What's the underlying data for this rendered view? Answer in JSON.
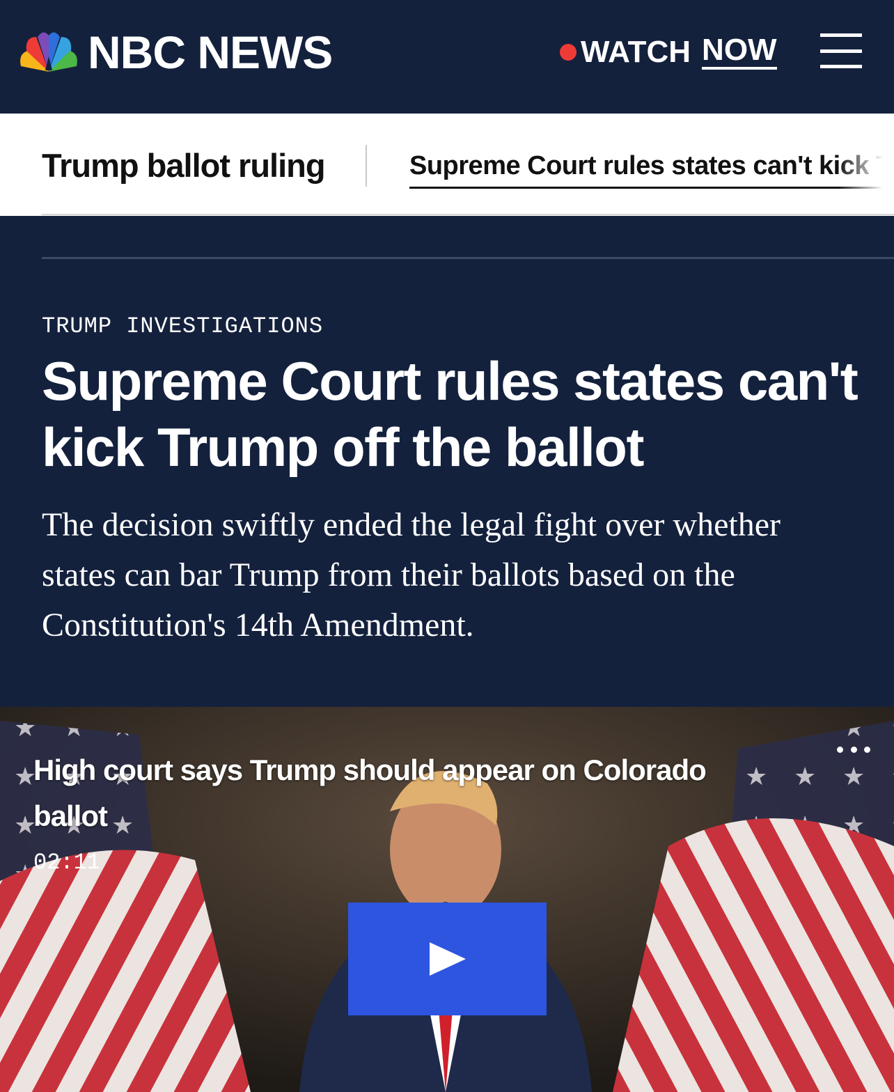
{
  "header": {
    "brand": "NBC NEWS",
    "watch_label": "WATCH",
    "now_label": "NOW",
    "live_dot_color": "#ef3b36",
    "menu_icon": "hamburger-menu-icon"
  },
  "subnav": {
    "title": "Trump ballot ruling",
    "active_link": "Supreme Court rules states can't kick T"
  },
  "article": {
    "eyebrow": "TRUMP INVESTIGATIONS",
    "headline": "Supreme Court rules states can't kick Trump off the ballot",
    "dek": "The decision swiftly ended the legal fight over whether states can bar Trump from their ballots based on the Constitution's 14th Amendment."
  },
  "video": {
    "title": "High court says Trump should appear on Colorado ballot",
    "duration": "02:11",
    "play_icon": "play-icon",
    "more_icon": "more-options-icon",
    "play_button_color": "#2d55e0"
  },
  "colors": {
    "navy": "#14213d",
    "white": "#ffffff"
  }
}
